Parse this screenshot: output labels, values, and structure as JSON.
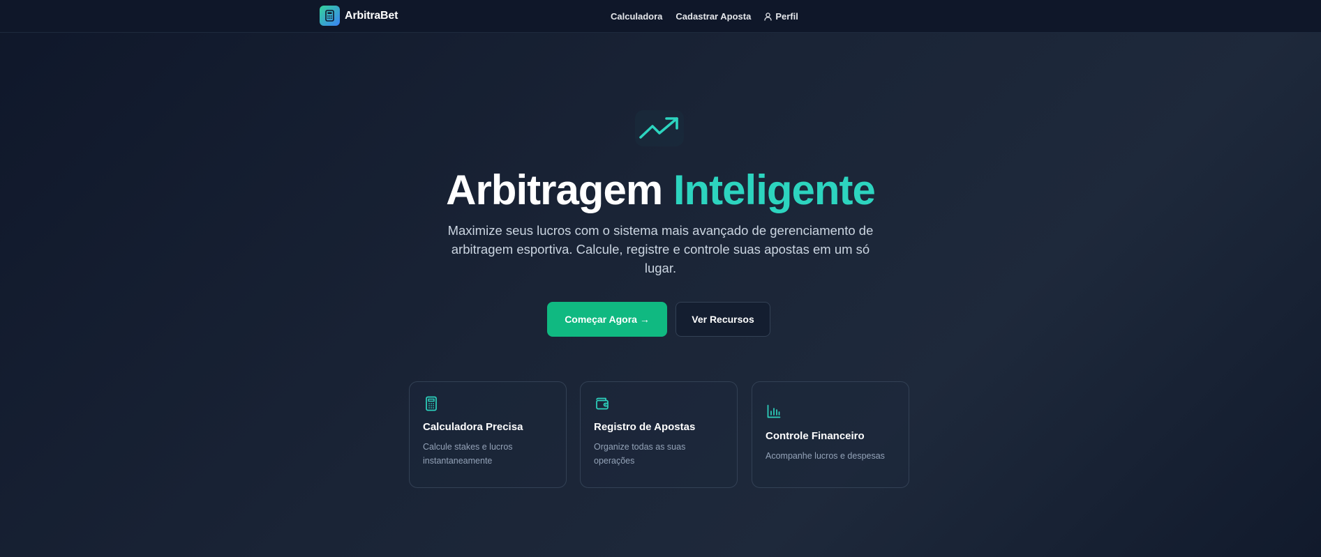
{
  "brand": {
    "name": "ArbitraBet",
    "accent_color": "#10b981",
    "logo_gradient": [
      "#34d399",
      "#3b82f6"
    ]
  },
  "nav": {
    "items": [
      {
        "label": "Calculadora"
      },
      {
        "label": "Cadastrar Aposta"
      },
      {
        "label": "Perfil",
        "icon": "user-icon"
      }
    ]
  },
  "hero": {
    "icon": "trending-up-icon",
    "title_plain": "Arbitragem",
    "title_accent": "Inteligente",
    "subtitle": "Maximize seus lucros com o sistema mais avançado de gerenciamento de arbitragem esportiva. Calcule, registre e controle suas apostas em um só lugar.",
    "primary_button": "Começar Agora →",
    "secondary_button": "Ver Recursos"
  },
  "features": [
    {
      "icon": "calculator-icon",
      "title": "Calculadora Precisa",
      "description": "Calcule stakes e lucros instantaneamente"
    },
    {
      "icon": "wallet-icon",
      "title": "Registro de Apostas",
      "description": "Organize todas as suas operações"
    },
    {
      "icon": "bar-chart-icon",
      "title": "Controle Financeiro",
      "description": "Acompanhe lucros e despesas"
    }
  ]
}
